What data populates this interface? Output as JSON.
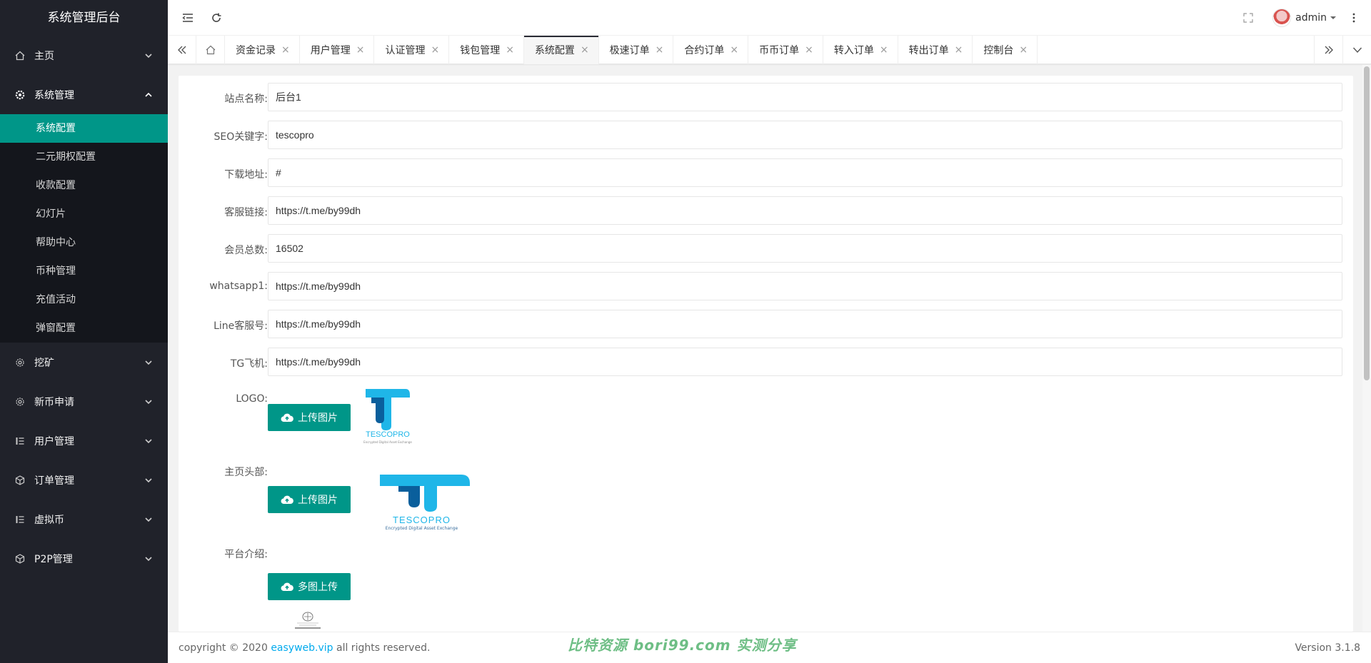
{
  "brand": "系统管理后台",
  "sidebar": {
    "items": [
      {
        "label": "主页",
        "icon": "home-icon"
      },
      {
        "label": "系统管理",
        "icon": "gear-icon"
      },
      {
        "label": "挖矿",
        "icon": "gear-outline-icon"
      },
      {
        "label": "新币申请",
        "icon": "gear-outline-icon"
      },
      {
        "label": "用户管理",
        "icon": "list-icon"
      },
      {
        "label": "订单管理",
        "icon": "cube-icon"
      },
      {
        "label": "虚拟币",
        "icon": "list-icon"
      },
      {
        "label": "P2P管理",
        "icon": "cube-icon"
      }
    ],
    "submenu": [
      "系统配置",
      "二元期权配置",
      "收款配置",
      "幻灯片",
      "帮助中心",
      "币种管理",
      "充值活动",
      "弹窗配置"
    ]
  },
  "header": {
    "username": "admin"
  },
  "tabs": [
    "资金记录",
    "用户管理",
    "认证管理",
    "钱包管理",
    "系统配置",
    "极速订单",
    "合约订单",
    "币币订单",
    "转入订单",
    "转出订单",
    "控制台"
  ],
  "form": {
    "fields": [
      {
        "label": "站点名称:",
        "value": "后台1"
      },
      {
        "label": "SEO关键字:",
        "value": "tescopro"
      },
      {
        "label": "下载地址:",
        "value": "#"
      },
      {
        "label": "客服链接:",
        "value": "https://t.me/by99dh"
      },
      {
        "label": "会员总数:",
        "value": "16502"
      },
      {
        "label": "whatsapp1:",
        "value": "https://t.me/by99dh"
      },
      {
        "label": "Line客服号:",
        "value": "https://t.me/by99dh"
      },
      {
        "label": "TG飞机:",
        "value": "https://t.me/by99dh"
      }
    ],
    "logo_label": "LOGO:",
    "banner_label": "主页头部:",
    "intro_label": "平台介绍:",
    "upload_label": "上传图片",
    "multi_upload_label": "多图上传",
    "logo_text": "TESCOPRO",
    "logo_tagline": "Encrypted Digital Asset Exchange",
    "banner_text": "TESCOPRO",
    "banner_tagline": "Encrypted Digital Asset Exchange"
  },
  "footer": {
    "copyright": "copyright © 2020",
    "link": "easyweb.vip",
    "rights": "all rights reserved.",
    "version": "Version 3.1.8"
  },
  "watermark": "比特资源 bori99.com 实测分享",
  "colors": {
    "accent": "#009688",
    "sidebar": "#20222a",
    "link": "#01aaed"
  }
}
